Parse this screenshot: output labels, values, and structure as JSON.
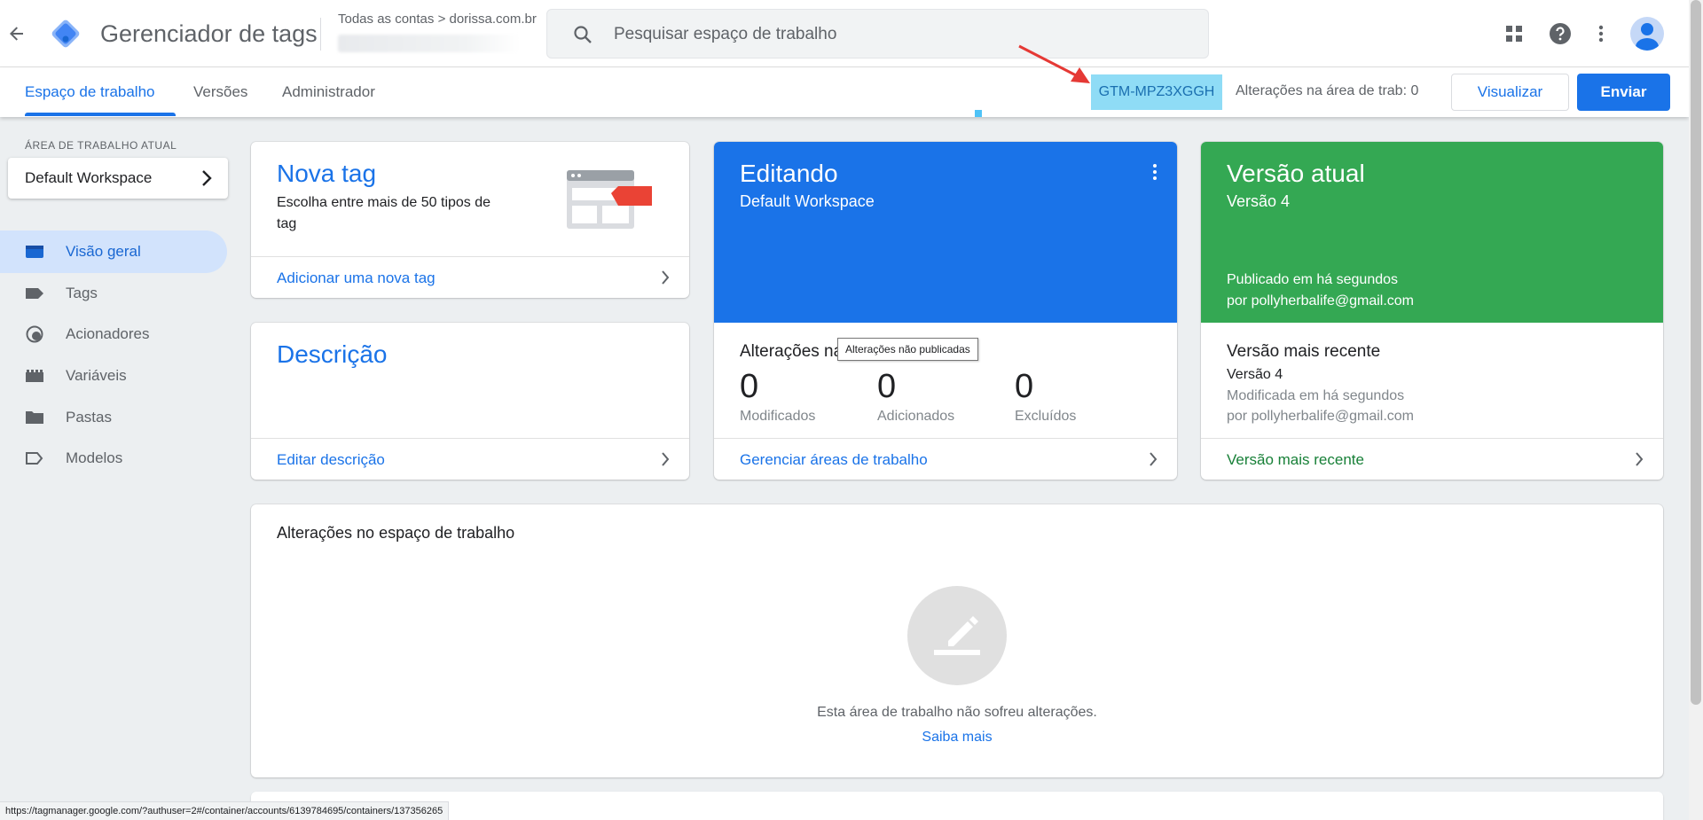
{
  "header": {
    "app_title": "Gerenciador de tags",
    "breadcrumb": "Todas as contas > dorissa.com.br",
    "search_placeholder": "Pesquisar espaço de trabalho"
  },
  "subnav": {
    "tabs": [
      {
        "label": "Espaço de trabalho",
        "active": true
      },
      {
        "label": "Versões",
        "active": false
      },
      {
        "label": "Administrador",
        "active": false
      }
    ],
    "container_id": "GTM-MPZ3XGGH",
    "workspace_changes": "Alterações na área de trab: 0",
    "preview_label": "Visualizar",
    "submit_label": "Enviar"
  },
  "sidebar": {
    "workspace_label": "ÁREA DE TRABALHO ATUAL",
    "workspace_name": "Default Workspace",
    "items": [
      {
        "label": "Visão geral",
        "icon": "overview-icon",
        "active": true
      },
      {
        "label": "Tags",
        "icon": "tag-icon",
        "active": false
      },
      {
        "label": "Acionadores",
        "icon": "trigger-icon",
        "active": false
      },
      {
        "label": "Variáveis",
        "icon": "variable-icon",
        "active": false
      },
      {
        "label": "Pastas",
        "icon": "folder-icon",
        "active": false
      },
      {
        "label": "Modelos",
        "icon": "template-icon",
        "active": false
      }
    ]
  },
  "new_tag": {
    "title": "Nova tag",
    "description": "Escolha entre mais de 50 tipos de tag",
    "link": "Adicionar uma nova tag"
  },
  "description_card": {
    "title": "Descrição",
    "link": "Editar descrição"
  },
  "editing": {
    "title": "Editando",
    "workspace": "Default Workspace",
    "changes_label": "Alterações na",
    "tooltip": "Alterações não publicadas",
    "stats": [
      {
        "value": "0",
        "label": "Modificados"
      },
      {
        "value": "0",
        "label": "Adicionados"
      },
      {
        "value": "0",
        "label": "Excluídos"
      }
    ],
    "link": "Gerenciar áreas de trabalho"
  },
  "current_version": {
    "title": "Versão atual",
    "version": "Versão 4",
    "published_line1": "Publicado em há segundos",
    "published_line2": "por pollyherbalife@gmail.com",
    "latest_title": "Versão mais recente",
    "latest_version": "Versão 4",
    "latest_modified": "Modificada em há segundos",
    "latest_by": "por pollyherbalife@gmail.com",
    "link": "Versão mais recente"
  },
  "workspace_changes_card": {
    "title": "Alterações no espaço de trabalho",
    "empty_text": "Esta área de trabalho não sofreu alterações.",
    "learn_more": "Saiba mais"
  },
  "status_bar": {
    "url": "https://tagmanager.google.com/?authuser=2#/container/accounts/6139784695/containers/137356265"
  },
  "colors": {
    "accent_blue": "#1a73e8",
    "green": "#34a853",
    "container_highlight": "#8fdcf6",
    "annotation_arrow": "#e53935"
  }
}
